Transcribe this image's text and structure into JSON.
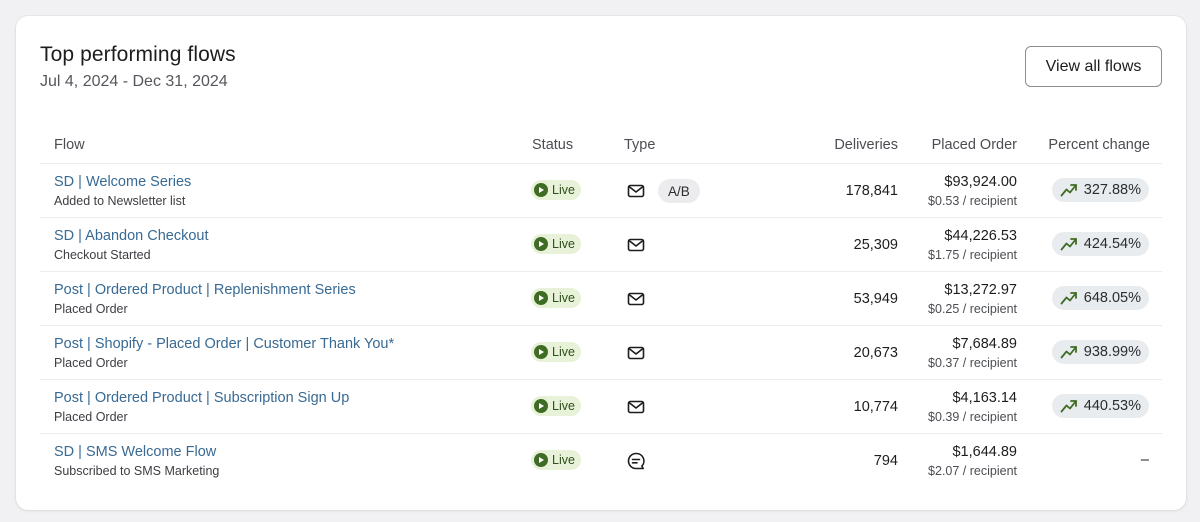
{
  "header": {
    "title": "Top performing flows",
    "date_range": "Jul 4, 2024 - Dec 31, 2024",
    "view_all_label": "View all flows"
  },
  "columns": {
    "flow": "Flow",
    "status": "Status",
    "type": "Type",
    "deliveries": "Deliveries",
    "placed_order": "Placed Order",
    "percent_change": "Percent change"
  },
  "colors": {
    "link": "#386a94",
    "live_badge_bg": "#e7f2d8",
    "live_dot": "#3f6c24",
    "trend_up": "#3f6c24"
  },
  "rows": [
    {
      "name": "SD | Welcome Series",
      "trigger": "Added to Newsletter list",
      "status": "Live",
      "type_icon": "email-icon",
      "ab_label": "A/B",
      "deliveries": "178,841",
      "placed_order": "$93,924.00",
      "per_recipient": "$0.53 / recipient",
      "percent_change": "327.88%",
      "trend_icon": "trend-up-icon"
    },
    {
      "name": "SD | Abandon Checkout",
      "trigger": "Checkout Started",
      "status": "Live",
      "type_icon": "email-icon",
      "deliveries": "25,309",
      "placed_order": "$44,226.53",
      "per_recipient": "$1.75 / recipient",
      "percent_change": "424.54%",
      "trend_icon": "trend-up-icon"
    },
    {
      "name": "Post | Ordered Product | Replenishment Series",
      "trigger": "Placed Order",
      "status": "Live",
      "type_icon": "email-icon",
      "deliveries": "53,949",
      "placed_order": "$13,272.97",
      "per_recipient": "$0.25 / recipient",
      "percent_change": "648.05%",
      "trend_icon": "trend-up-icon"
    },
    {
      "name": "Post | Shopify - Placed Order | Customer Thank You*",
      "trigger": "Placed Order",
      "status": "Live",
      "type_icon": "email-icon",
      "deliveries": "20,673",
      "placed_order": "$7,684.89",
      "per_recipient": "$0.37 / recipient",
      "percent_change": "938.99%",
      "trend_icon": "trend-up-icon"
    },
    {
      "name": "Post | Ordered Product | Subscription Sign Up",
      "trigger": "Placed Order",
      "status": "Live",
      "type_icon": "email-icon",
      "deliveries": "10,774",
      "placed_order": "$4,163.14",
      "per_recipient": "$0.39 / recipient",
      "percent_change": "440.53%",
      "trend_icon": "trend-up-icon"
    },
    {
      "name": "SD | SMS Welcome Flow",
      "trigger": "Subscribed to SMS Marketing",
      "status": "Live",
      "type_icon": "sms-icon",
      "deliveries": "794",
      "placed_order": "$1,644.89",
      "per_recipient": "$2.07 / recipient",
      "percent_change": "–"
    }
  ]
}
